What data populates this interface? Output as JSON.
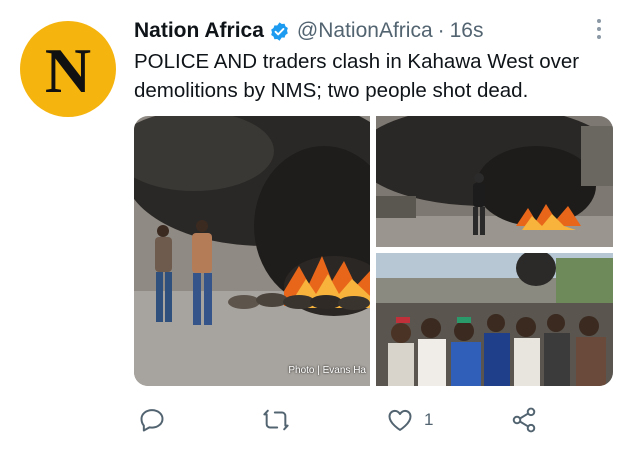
{
  "account": {
    "name": "Nation Africa",
    "handle": "@NationAfrica",
    "separator": "·",
    "time": "16s",
    "avatar_letter": "N",
    "avatar_color": "#f6b40e",
    "verified_color": "#1d9bf0"
  },
  "tweet": {
    "text": "POLICE AND traders clash in Kahawa West over demolitions by NMS; two people shot dead."
  },
  "media": {
    "photo_credit": "Photo | Evans Ha"
  },
  "actions": {
    "reply_icon": "reply-icon",
    "retweet_icon": "retweet-icon",
    "like_icon": "heart-icon",
    "like_count": "1",
    "share_icon": "share-icon"
  }
}
